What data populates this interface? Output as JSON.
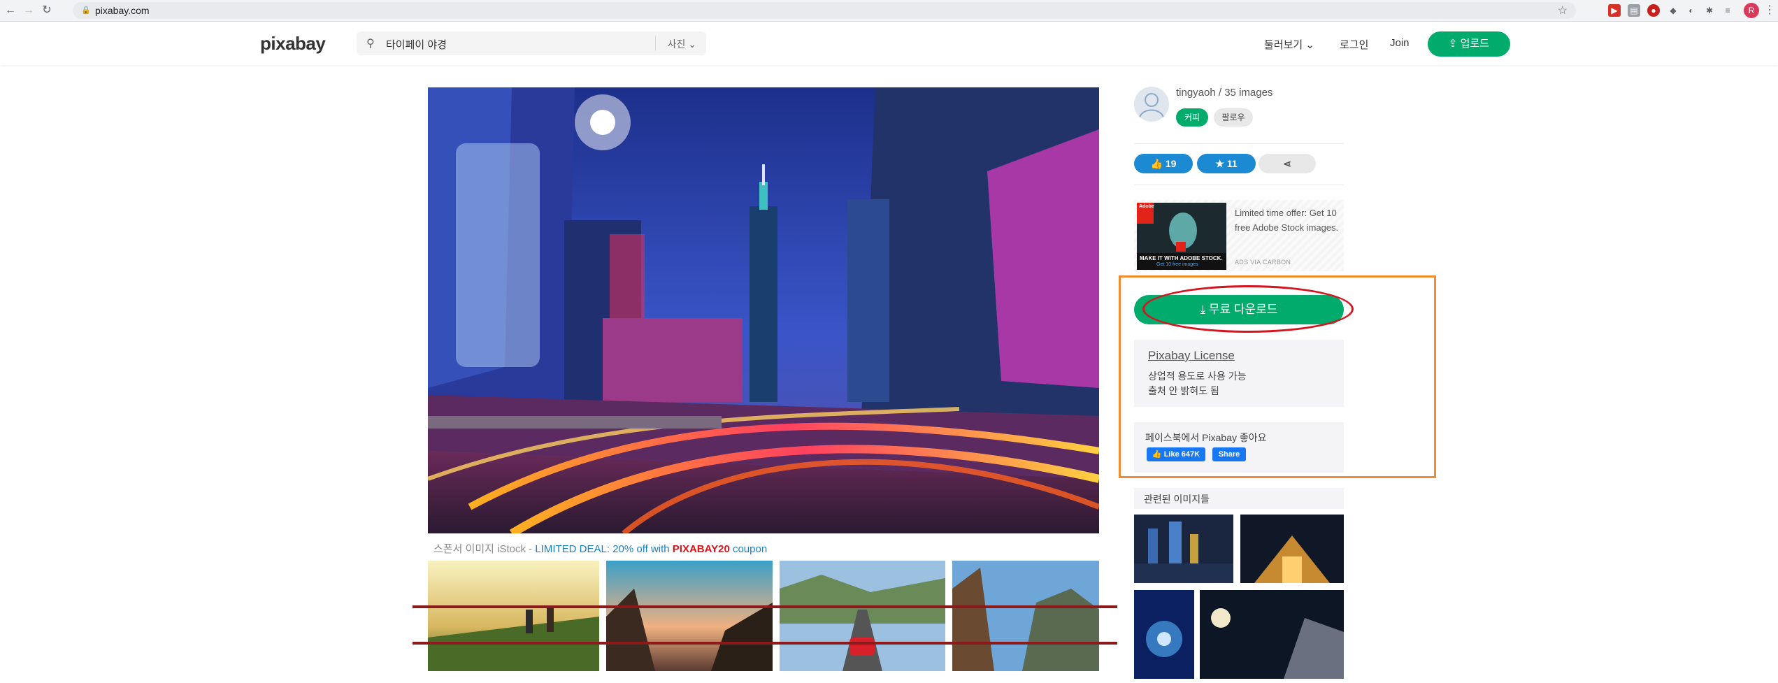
{
  "browser": {
    "url": "pixabay.com",
    "profile_initial": "R"
  },
  "header": {
    "logo": "pixabay",
    "search_query": "타이페이 야경",
    "search_type": "사진",
    "nav_explore": "둘러보기",
    "nav_login": "로그인",
    "nav_join": "Join",
    "upload_label": "업로드"
  },
  "sponsor": {
    "prefix": "스폰서 이미지 iStock - ",
    "deal": "LIMITED DEAL: 20% off with ",
    "code": "PIXABAY20",
    "suffix": " coupon"
  },
  "author": {
    "name_line": "tingyaoh / 35 images",
    "coffee_label": "커피",
    "follow_label": "팔로우"
  },
  "stats": {
    "likes": "19",
    "favorites": "11"
  },
  "ad": {
    "text": "Limited time offer: Get 10 free Adobe Stock images.",
    "via": "ADS VIA CARBON",
    "img_brand": "Adobe",
    "img_caption": "MAKE IT WITH ADOBE STOCK.",
    "img_sub": "Get 10 free images"
  },
  "download": {
    "label": "무료 다운로드"
  },
  "license": {
    "title": "Pixabay License",
    "line1": "상업적 용도로 사용 가능",
    "line2": "출처 안 밝혀도 됨"
  },
  "facebook": {
    "text": "페이스북에서 Pixabay 좋아요",
    "like_label": "Like 647K",
    "share_label": "Share"
  },
  "related": {
    "heading": "관련된 이미지들"
  },
  "colors": {
    "brand_green": "#00ab6c",
    "stat_blue": "#1b8ad3",
    "annotation_orange": "#f28a30",
    "annotation_red": "#d4141f"
  }
}
